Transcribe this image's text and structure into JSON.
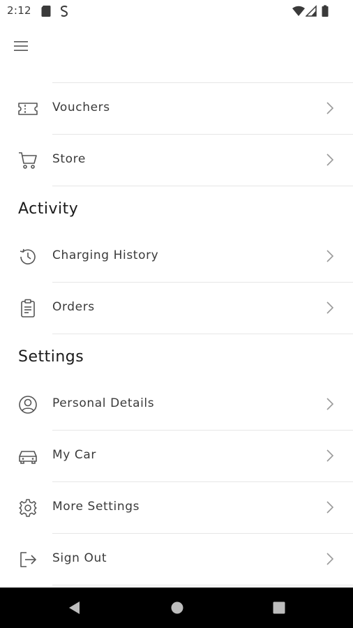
{
  "status_bar": {
    "time": "2:12"
  },
  "app_bar": {
    "menu_icon": "hamburger-menu-icon"
  },
  "menu": {
    "items_top": [
      {
        "label": "Vouchers",
        "icon": "voucher-ticket-icon"
      },
      {
        "label": "Store",
        "icon": "shopping-cart-icon"
      }
    ],
    "activity": {
      "title": "Activity",
      "items": [
        {
          "label": "Charging History",
          "icon": "history-clock-icon"
        },
        {
          "label": "Orders",
          "icon": "clipboard-icon"
        }
      ]
    },
    "settings": {
      "title": "Settings",
      "items": [
        {
          "label": "Personal Details",
          "icon": "user-profile-icon"
        },
        {
          "label": "My Car",
          "icon": "car-icon"
        },
        {
          "label": "More Settings",
          "icon": "gear-icon"
        },
        {
          "label": "Sign Out",
          "icon": "sign-out-icon"
        }
      ]
    }
  },
  "colors": {
    "text": "#3a3a3a",
    "heading": "#1a1a1a",
    "divider": "#e6e6e6",
    "icon": "#555555",
    "nav_bar": "#000000"
  }
}
